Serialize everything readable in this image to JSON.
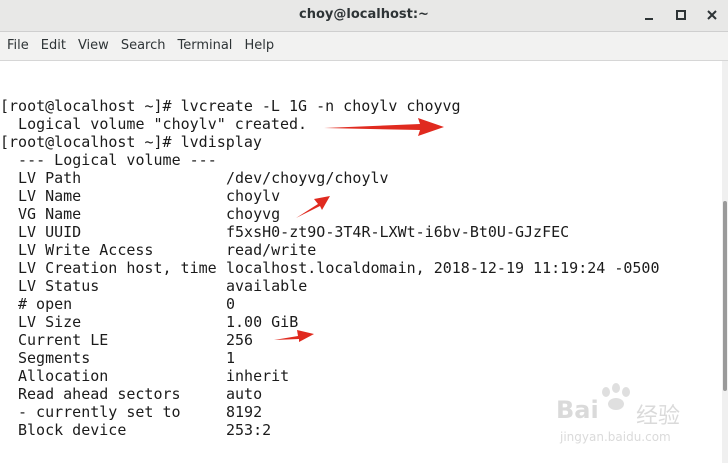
{
  "window": {
    "title": "choy@localhost:~"
  },
  "menu": [
    "File",
    "Edit",
    "View",
    "Search",
    "Terminal",
    "Help"
  ],
  "terminal": {
    "commands": [
      {
        "prompt": "[root@localhost ~]# ",
        "command": "lvcreate -L 1G -n choylv choyvg"
      },
      {
        "output": "  Logical volume \"choylv\" created."
      },
      {
        "prompt": "[root@localhost ~]# ",
        "command": "lvdisplay"
      },
      {
        "output": "  --- Logical volume ---"
      }
    ],
    "lv_fields": [
      {
        "label": "LV Path",
        "value": "/dev/choyvg/choylv"
      },
      {
        "label": "LV Name",
        "value": "choylv"
      },
      {
        "label": "VG Name",
        "value": "choyvg"
      },
      {
        "label": "LV UUID",
        "value": "f5xsH0-zt9O-3T4R-LXWt-i6bv-Bt0U-GJzFEC"
      },
      {
        "label": "LV Write Access",
        "value": "read/write"
      },
      {
        "label": "LV Creation host, time",
        "value": "localhost.localdomain, 2018-12-19 11:19:24 -0500"
      },
      {
        "label": "LV Status",
        "value": "available"
      },
      {
        "label": "# open",
        "value": "0"
      },
      {
        "label": "LV Size",
        "value": "1.00 GiB"
      },
      {
        "label": "Current LE",
        "value": "256"
      },
      {
        "label": "Segments",
        "value": "1"
      },
      {
        "label": "Allocation",
        "value": "inherit"
      },
      {
        "label": "Read ahead sectors",
        "value": "auto"
      },
      {
        "label": "- currently set to",
        "value": "8192"
      },
      {
        "label": "Block device",
        "value": "253:2"
      }
    ]
  },
  "watermark": {
    "brand": "Bai",
    "brand_suffix": "经验",
    "url": "jingyan.baidu.com"
  },
  "colors": {
    "arrow": "#e02a1f",
    "text": "#1b1b1b",
    "titlebar": "#e8e8e7"
  }
}
